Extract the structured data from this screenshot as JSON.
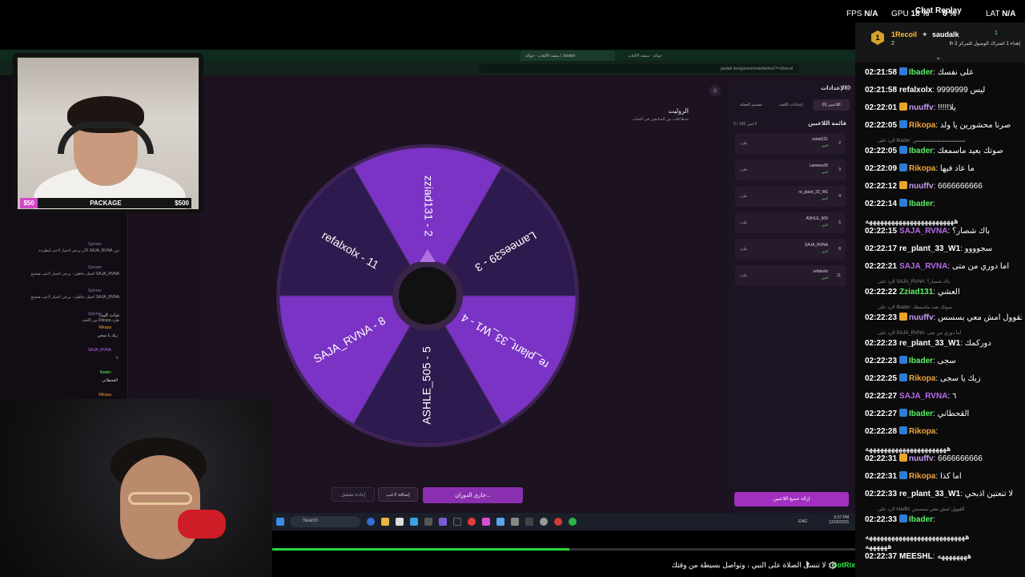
{
  "hud": {
    "fps_label": "FPS",
    "fps_value": "N/A",
    "gpu_label": "GPU",
    "gpu_value": "18 %",
    "cpu_value": "6 %",
    "lat_label": "LAT",
    "lat_value": "N/A",
    "chat_replay": "Chat Replay"
  },
  "browser": {
    "tab_active": "منصة الألعاب - جواله | Jawlah",
    "tab_other": "جواله - منصة الألعاب",
    "url": "jawlah.live/games/roulette/kick?=1Recoil"
  },
  "wheel": {
    "title": "الروليت",
    "subtitle": "خذها قلب بين المتابعين في الشات",
    "segments": [
      "zziad131 - 2",
      "Lamees39 - 3",
      "re_plant_33_W1 - 4",
      "ASHLE_505 - 5",
      "SAJA_RVNA - 8",
      "refalxolx - 11"
    ],
    "colors": {
      "light": "#7a33c4",
      "dark": "#2d1a4e",
      "rim": "#3d2254",
      "hub": "#3a2448"
    }
  },
  "settings": {
    "title": "الإعدادات",
    "tabs": [
      "اللاعبين (6)",
      "إعدادات اللعبة",
      "تصميم العجلة"
    ],
    "list_title": "قائمة اللاعبين",
    "count": "6 / 100 لاعبين",
    "players": [
      {
        "name": "zziad131",
        "num": "2",
        "status": "الفوز",
        "action": "طرد"
      },
      {
        "name": "Lamees39",
        "num": "3",
        "status": "الفوز",
        "action": "طرد"
      },
      {
        "name": "re_plant_33_W1",
        "num": "4",
        "status": "الفوز",
        "action": "طرد"
      },
      {
        "name": "ASHLE_505",
        "num": "5",
        "status": "الفوز",
        "action": "طرد"
      },
      {
        "name": "SAJA_RVNA",
        "num": "8",
        "status": "الفوز",
        "action": "طرد"
      },
      {
        "name": "refalxolx",
        "num": "11",
        "status": "الفوز",
        "action": "طرد"
      }
    ],
    "remove_all": "إزالة جميع اللاعبين"
  },
  "controls": {
    "spin": "جاري الدوران...",
    "add_player": "إضافة لاعب",
    "reset": "إعادة تشغيل"
  },
  "taskbar": {
    "search": "Search",
    "lang": "ENG",
    "time": "9:37 PM",
    "date": "12/26/2025"
  },
  "package": {
    "left": "$50",
    "center": "PACKAGE",
    "right": "$500"
  },
  "left_panel": {
    "chat_title": "شات البث",
    "msgs": [
      {
        "user": "Rikopa",
        "text": "زيك يا سجي"
      },
      {
        "user": "SAJA_RVNA",
        "text": "٦"
      },
      {
        "user": "Ibader",
        "text": "القحطاني"
      },
      {
        "user": "Rikopa",
        "text": ""
      }
    ],
    "system": [
      {
        "user": "Spinner",
        "text": "دور SAJA_RVNA الآن يرجى اختيار لاعب ليطرده"
      },
      {
        "user": "Spinner",
        "text": "SAJA_RVNA اختيار خاطئ - يرجى اختيار لاعب صحيح"
      },
      {
        "user": "Spinner",
        "text": "SAJA_RVNA اختيار خاطئ - يرجى اختيار لاعب صحيح"
      },
      {
        "user": "Spinner",
        "text": "طرد Rikopa من اللعبة"
      }
    ]
  },
  "progress": {
    "value": 0.51,
    "color": "#27d83a"
  },
  "ticker": {
    "user": "BotRix",
    "text": "لا تنسى الصلاة على النبي ، وتواصل بسيطة من وقتك"
  },
  "chat": {
    "header": {
      "rank": "1",
      "top_user": "1Recoil",
      "top_count": "2",
      "user2": "saudalk",
      "user2_count": "1",
      "user2_sub": "إهداء 1 اشتراك الوصول للمركز 3 th"
    },
    "messages": [
      {
        "time": "02:21:58",
        "user": "Ibader",
        "color": "#5ef06a",
        "badge": "bolt",
        "text": "على نفسك"
      },
      {
        "time": "02:21:58",
        "user": "refalxolx",
        "color": "#ffffff",
        "badge": "none",
        "text": "ليس 9999999"
      },
      {
        "time": "02:22:01",
        "user": "nuuffv",
        "color": "#c69cf5",
        "badge": "crown",
        "text": "!!!!!يلا"
      },
      {
        "time": "02:22:05",
        "user": "Rikopa",
        "color": "#f2a43a",
        "badge": "bolt",
        "text": "صرنا محشورين يا ولد"
      },
      {
        "reply": "الرد على Ibader: سسسسسسسسسسسس"
      },
      {
        "time": "02:22:05",
        "user": "Ibader",
        "color": "#5ef06a",
        "badge": "bolt",
        "text": "صوتك بعيد ماسمعك"
      },
      {
        "time": "02:22:09",
        "user": "Rikopa",
        "color": "#f2a43a",
        "badge": "bolt",
        "text": "ما عاد فيها"
      },
      {
        "time": "02:22:12",
        "user": "nuuffv",
        "color": "#c69cf5",
        "badge": "crown",
        "text": "6666666666"
      },
      {
        "time": "02:22:14",
        "user": "Ibader",
        "color": "#5ef06a",
        "badge": "bolt",
        "text": ""
      },
      {
        "text_only": "ههههههههههههههههههههههههه"
      },
      {
        "time": "02:22:15",
        "user": "SAJA_RVNA",
        "color": "#b86bf0",
        "badge": "none",
        "text": "باك شصار؟"
      },
      {
        "time": "02:22:17",
        "user": "re_plant_33_W1",
        "color": "#ffffff",
        "badge": "none",
        "text": "سجوووو"
      },
      {
        "time": "02:22:21",
        "user": "SAJA_RVNA",
        "color": "#b86bf0",
        "badge": "none",
        "text": "اما دوري من متى"
      },
      {
        "reply": "الرد على SAJA_RVNA: باك شصار؟"
      },
      {
        "time": "02:22:22",
        "user": "Zziad131",
        "color": "#5ef06a",
        "badge": "none",
        "text": "العشي"
      },
      {
        "reply": "الرد على Ibader: صوتك بعيد ماسمعك"
      },
      {
        "time": "02:22:23",
        "user": "nuuffv",
        "color": "#c69cf5",
        "badge": "crown",
        "text": "القوول امش معي بسسس"
      },
      {
        "reply": "الرد على SAJA_RVNA: اما دوري من متى"
      },
      {
        "time": "02:22:23",
        "user": "re_plant_33_W1",
        "color": "#ffffff",
        "badge": "none",
        "text": "دوركمك"
      },
      {
        "time": "02:22:23",
        "user": "Ibader",
        "color": "#5ef06a",
        "badge": "bolt",
        "text": "سجى"
      },
      {
        "time": "02:22:25",
        "user": "Rikopa",
        "color": "#f2a43a",
        "badge": "bolt",
        "text": "زيك يا سجى"
      },
      {
        "time": "02:22:27",
        "user": "SAJA_RVNA",
        "color": "#b86bf0",
        "badge": "none",
        "text": "٦"
      },
      {
        "time": "02:22:27",
        "user": "Ibader",
        "color": "#5ef06a",
        "badge": "bolt",
        "text": "القحطاني"
      },
      {
        "time": "02:22:28",
        "user": "Rikopa",
        "color": "#f2a43a",
        "badge": "bolt",
        "text": ""
      },
      {
        "text_only": "ههههههههههههههههههههههه"
      },
      {
        "time": "02:22:31",
        "user": "nuuffv",
        "color": "#c69cf5",
        "badge": "crown",
        "text": "6666666666"
      },
      {
        "time": "02:22:31",
        "user": "Rikopa",
        "color": "#f2a43a",
        "badge": "bolt",
        "text": "اما كذا"
      },
      {
        "time": "02:22:33",
        "user": "re_plant_33_W1",
        "color": "#ffffff",
        "badge": "none",
        "text": "لا تنعتين اذبحي"
      },
      {
        "reply": "الرد على nuuffv: القوول امش معي بسسس"
      },
      {
        "time": "02:22:33",
        "user": "Ibader",
        "color": "#5ef06a",
        "badge": "bolt",
        "text": ""
      },
      {
        "text_only": "هههههههههههههههههههههههههههه"
      },
      {
        "text_only": "ههههههه"
      },
      {
        "time": "02:22:37",
        "user": "MEESHL",
        "color": "#ffffff",
        "badge": "none",
        "text": "ههههههههه"
      }
    ]
  }
}
